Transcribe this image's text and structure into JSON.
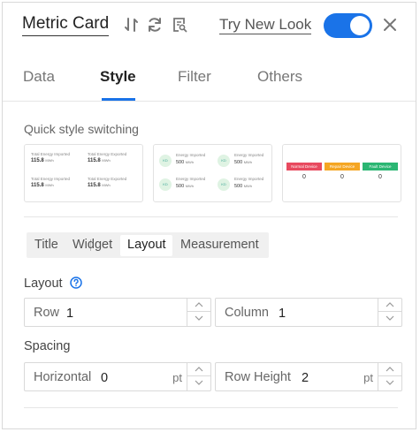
{
  "header": {
    "title": "Metric Card",
    "try_label": "Try New Look",
    "toggle_on": true,
    "icons": [
      "sort-icon",
      "refresh-icon",
      "preview-icon",
      "close-icon"
    ]
  },
  "tabs": [
    {
      "label": "Data"
    },
    {
      "label": "Style",
      "active": true
    },
    {
      "label": "Filter"
    },
    {
      "label": "Others"
    }
  ],
  "quick_style": {
    "label": "Quick style switching",
    "card1": [
      {
        "caption": "Total Energy Imported",
        "value": "115.8",
        "unit": "MWh"
      },
      {
        "caption": "Total Energy Exported",
        "value": "115.8",
        "unit": "MWh"
      },
      {
        "caption": "Total Energy Imported",
        "value": "115.8",
        "unit": "MWh"
      },
      {
        "caption": "Total Energy Exported",
        "value": "115.8",
        "unit": "MWh"
      }
    ],
    "card2": [
      {
        "icon": "KD",
        "caption": "Energy Imported",
        "value": "500",
        "unit": "MWh"
      },
      {
        "icon": "KD",
        "caption": "Energy Imported",
        "value": "500",
        "unit": "MWh"
      },
      {
        "icon": "KD",
        "caption": "Energy Imported",
        "value": "500",
        "unit": "MWh"
      },
      {
        "icon": "KD",
        "caption": "Energy Imported",
        "value": "500",
        "unit": "MWh"
      }
    ],
    "card3": [
      {
        "label": "Normal Device",
        "value": "0",
        "color": "#e84a5f"
      },
      {
        "label": "Repair Device",
        "value": "0",
        "color": "#f5a623"
      },
      {
        "label": "Fault Device",
        "value": "0",
        "color": "#2bb673"
      }
    ]
  },
  "segments": [
    {
      "label": "Title"
    },
    {
      "label": "Widget"
    },
    {
      "label": "Layout",
      "active": true
    },
    {
      "label": "Measurement"
    }
  ],
  "layout": {
    "label": "Layout",
    "row_label": "Row",
    "row_value": "1",
    "column_label": "Column",
    "column_value": "1"
  },
  "spacing": {
    "label": "Spacing",
    "horizontal_label": "Horizontal",
    "horizontal_value": "0",
    "horizontal_unit": "pt",
    "row_height_label": "Row Height",
    "row_height_value": "2",
    "row_height_unit": "pt"
  },
  "colors": {
    "accent": "#1a73e8"
  }
}
